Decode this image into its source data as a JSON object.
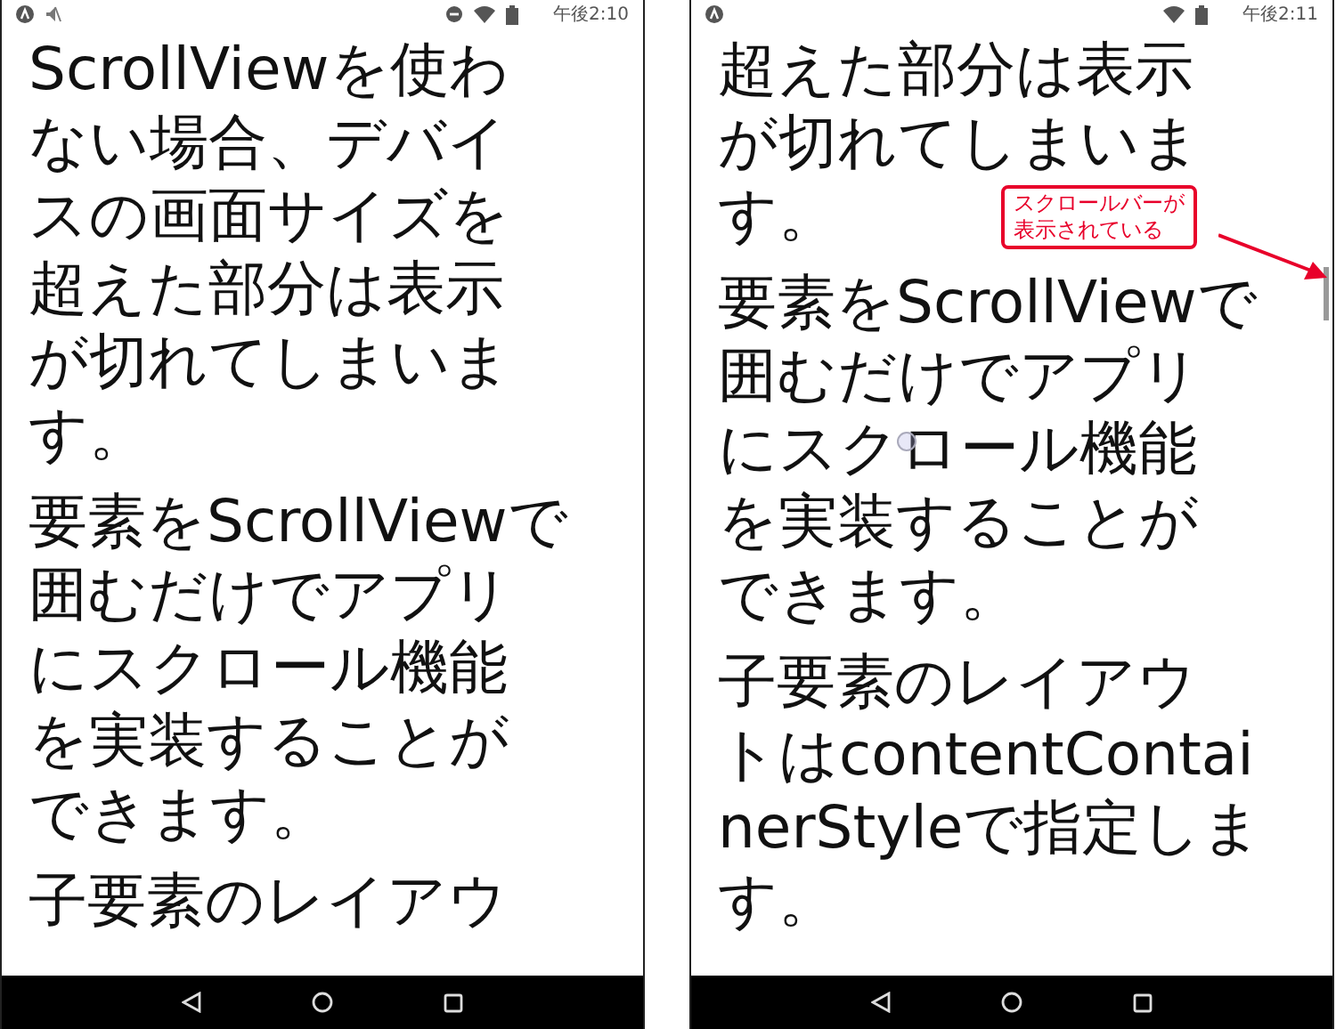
{
  "screens": [
    {
      "status_bar": {
        "left_icons": [
          {
            "kind": "alert"
          },
          {
            "kind": "mute"
          }
        ],
        "right_icons": [
          {
            "kind": "dnd"
          },
          {
            "kind": "wifi"
          },
          {
            "kind": "battery"
          }
        ],
        "time": "午後2:10"
      },
      "paragraphs": [
        {
          "lines": [
            "ScrollViewを使わ",
            "ない場合、デバイ",
            "スの画面サイズを",
            "超えた部分は表示",
            "が切れてしまいま",
            "す。"
          ]
        },
        {
          "lines": [
            "要素をScrollViewで",
            "囲むだけでアプリ",
            "にスクロール機能",
            "を実装することが",
            "できます。"
          ]
        },
        {
          "lines": [
            "子要素のレイアウ"
          ]
        }
      ]
    },
    {
      "status_bar": {
        "left_icons": [
          {
            "kind": "alert"
          }
        ],
        "right_icons": [
          {
            "kind": "wifi"
          },
          {
            "kind": "battery"
          }
        ],
        "time": "午後2:11"
      },
      "scrollbar": true,
      "touch": true,
      "paragraphs": [
        {
          "lines": [
            "超えた部分は表示",
            "が切れてしまいま",
            "す。"
          ]
        },
        {
          "lines": [
            "要素をScrollViewで",
            "囲むだけでアプリ",
            "にスクロール機能",
            "を実装することが",
            "できます。"
          ]
        },
        {
          "lines": [
            "子要素のレイアウ",
            "トはcontentContai",
            "nerStyleで指定しま",
            "す。"
          ]
        }
      ],
      "callout": {
        "lines": [
          "スクロールバーが",
          "表示されている"
        ]
      }
    }
  ]
}
